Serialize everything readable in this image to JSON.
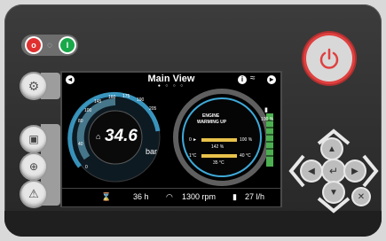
{
  "screen": {
    "title": "Main View",
    "page_dots": "● ○ ○ ○",
    "info_icon": "info-icon",
    "gauge": {
      "value": "34.6",
      "unit": "bar",
      "unit_label": "bar",
      "ticks": [
        "0",
        "40",
        "80",
        "100",
        "145",
        "160",
        "175",
        "190",
        "205"
      ],
      "warning_line1": "ENGINE",
      "warning_line2": "WARMING UP",
      "bar1_left": "0 ►",
      "bar1_right": "100 %",
      "bar1_value": "142 %",
      "bar2_left": "1°C",
      "bar2_right": "40 °C",
      "bar2_value": "35 °C",
      "fuel_pct": "100 %"
    },
    "status": {
      "hours": "36 h",
      "rpm": "1300 rpm",
      "fuel_rate": "27 l/h"
    }
  },
  "colors": {
    "accent": "#3fa9d8",
    "power_ring": "#e04040",
    "fuel_green": "#4caf50",
    "led_red": "#e03030",
    "led_green": "#1aa84a"
  }
}
